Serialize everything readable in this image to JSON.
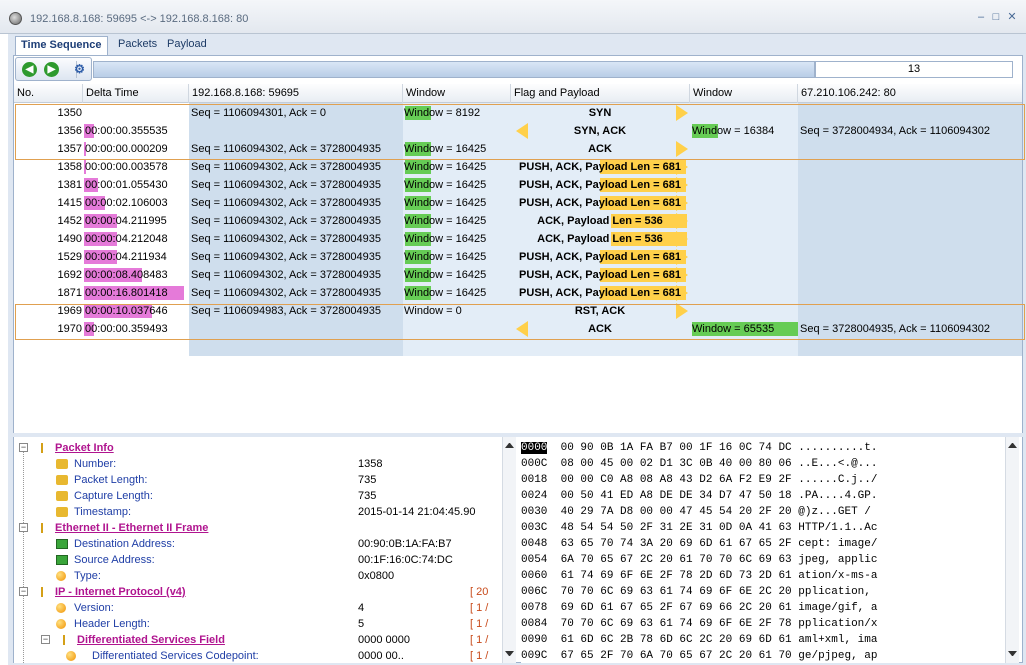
{
  "window": {
    "title": "192.168.8.168: 59695 <-> 192.168.8.168: 80"
  },
  "tabs": [
    {
      "label": "Time Sequence",
      "active": true
    },
    {
      "label": "Packets",
      "active": false
    },
    {
      "label": "Payload",
      "active": false
    }
  ],
  "toolbar": {
    "count": "13"
  },
  "columns": [
    "No.",
    "Delta Time",
    "192.168.8.168: 59695",
    "Window",
    "Flag and Payload",
    "Window",
    "67.210.106.242: 80"
  ],
  "colors": {
    "delta_bar": "#e57ad9",
    "window_bar": "#66cc55",
    "arrow": "#ffd04a",
    "group_border": "#e0a050"
  },
  "packets": [
    {
      "no": "1350",
      "delta": "",
      "seq_a": "Seq = 1106094301, Ack = 0",
      "win_a": "Window = 8192",
      "flag": "SYN",
      "dir": "right",
      "win_b": "",
      "seq_b": ""
    },
    {
      "no": "1356",
      "delta": "00:00:00.355535",
      "seq_a": "",
      "win_a": "",
      "flag": "SYN, ACK",
      "dir": "left",
      "win_b": "Window = 16384",
      "seq_b": "Seq = 3728004934, Ack = 1106094302"
    },
    {
      "no": "1357",
      "delta": "00:00:00.000209",
      "seq_a": "Seq = 1106094302, Ack = 3728004935",
      "win_a": "Window = 16425",
      "flag": "ACK",
      "dir": "right",
      "win_b": "",
      "seq_b": ""
    },
    {
      "no": "1358",
      "delta": "00:00:00.003578",
      "seq_a": "Seq = 1106094302, Ack = 3728004935",
      "win_a": "Window = 16425",
      "flag": "PUSH, ACK, Payload Len = 681",
      "dir": "right",
      "win_b": "",
      "seq_b": ""
    },
    {
      "no": "1381",
      "delta": "00:00:01.055430",
      "seq_a": "Seq = 1106094302, Ack = 3728004935",
      "win_a": "Window = 16425",
      "flag": "PUSH, ACK, Payload Len = 681",
      "dir": "right",
      "win_b": "",
      "seq_b": ""
    },
    {
      "no": "1415",
      "delta": "00:00:02.106003",
      "seq_a": "Seq = 1106094302, Ack = 3728004935",
      "win_a": "Window = 16425",
      "flag": "PUSH, ACK, Payload Len = 681",
      "dir": "right",
      "win_b": "",
      "seq_b": ""
    },
    {
      "no": "1452",
      "delta": "00:00:04.211995",
      "seq_a": "Seq = 1106094302, Ack = 3728004935",
      "win_a": "Window = 16425",
      "flag": "ACK, Payload Len = 536",
      "dir": "right",
      "win_b": "",
      "seq_b": ""
    },
    {
      "no": "1490",
      "delta": "00:00:04.212048",
      "seq_a": "Seq = 1106094302, Ack = 3728004935",
      "win_a": "Window = 16425",
      "flag": "ACK, Payload Len = 536",
      "dir": "right",
      "win_b": "",
      "seq_b": ""
    },
    {
      "no": "1529",
      "delta": "00:00:04.211934",
      "seq_a": "Seq = 1106094302, Ack = 3728004935",
      "win_a": "Window = 16425",
      "flag": "PUSH, ACK, Payload Len = 681",
      "dir": "right",
      "win_b": "",
      "seq_b": ""
    },
    {
      "no": "1692",
      "delta": "00:00:08.408483",
      "seq_a": "Seq = 1106094302, Ack = 3728004935",
      "win_a": "Window = 16425",
      "flag": "PUSH, ACK, Payload Len = 681",
      "dir": "right",
      "win_b": "",
      "seq_b": ""
    },
    {
      "no": "1871",
      "delta": "00:00:16.801418",
      "seq_a": "Seq = 1106094302, Ack = 3728004935",
      "win_a": "Window = 16425",
      "flag": "PUSH, ACK, Payload Len = 681",
      "dir": "right",
      "win_b": "",
      "seq_b": ""
    },
    {
      "no": "1969",
      "delta": "00:00:10.037646",
      "seq_a": "Seq = 1106094983, Ack = 3728004935",
      "win_a": "Window = 0",
      "flag": "RST, ACK",
      "dir": "right",
      "win_b": "",
      "seq_b": ""
    },
    {
      "no": "1970",
      "delta": "00:00:00.359493",
      "seq_a": "",
      "win_a": "",
      "flag": "ACK",
      "dir": "left",
      "win_b": "Window = 65535",
      "seq_b": "Seq = 3728004935, Ack = 1106094302"
    }
  ],
  "tree": [
    {
      "level": 0,
      "kind": "header",
      "icon": "node-icon",
      "label": "Packet Info",
      "value": "",
      "bracket": ""
    },
    {
      "level": 1,
      "kind": "field",
      "icon": "field-icon",
      "label": "Number:",
      "value": "1358",
      "bracket": ""
    },
    {
      "level": 1,
      "kind": "field",
      "icon": "field-icon",
      "label": "Packet Length:",
      "value": "735",
      "bracket": ""
    },
    {
      "level": 1,
      "kind": "field",
      "icon": "field-icon",
      "label": "Capture Length:",
      "value": "735",
      "bracket": ""
    },
    {
      "level": 1,
      "kind": "field",
      "icon": "field-icon",
      "label": "Timestamp:",
      "value": "2015-01-14 21:04:45.90",
      "bracket": ""
    },
    {
      "level": 0,
      "kind": "header",
      "icon": "node-icon",
      "label": "Ethernet II - Ethernet II Frame",
      "value": "",
      "bracket": ""
    },
    {
      "level": 1,
      "kind": "field",
      "icon": "mac-icon",
      "label": "Destination Address:",
      "value": "00:90:0B:1A:FA:B7",
      "bracket": ""
    },
    {
      "level": 1,
      "kind": "field",
      "icon": "mac-icon",
      "label": "Source Address:",
      "value": "00:1F:16:0C:74:DC",
      "bracket": ""
    },
    {
      "level": 1,
      "kind": "field",
      "icon": "orb-icon",
      "label": "Type:",
      "value": "0x0800",
      "bracket": ""
    },
    {
      "level": 0,
      "kind": "header",
      "icon": "node-icon",
      "label": "IP - Internet Protocol (v4)",
      "value": "",
      "bracket": "[ 20"
    },
    {
      "level": 1,
      "kind": "field",
      "icon": "orb-icon",
      "label": "Version:",
      "value": "4",
      "bracket": "[ 1 /"
    },
    {
      "level": 1,
      "kind": "field",
      "icon": "orb-icon",
      "label": "Header Length:",
      "value": "5",
      "bracket": "[ 1 /"
    },
    {
      "level": 1,
      "kind": "header",
      "icon": "node-icon",
      "label": "Differentiated Services Field",
      "value": "0000 0000",
      "bracket": "[ 1 /"
    },
    {
      "level": 2,
      "kind": "field",
      "icon": "orb-icon",
      "label": "Differentiated Services Codepoint:",
      "value": "0000 00..",
      "bracket": "[ 1 /"
    }
  ],
  "hex": {
    "selected": "0000",
    "rows": [
      {
        "off": "0000",
        "bytes": "00 90 0B 1A FA B7 00 1F 16 0C 74 DC",
        "ascii": "..........t."
      },
      {
        "off": "000C",
        "bytes": "08 00 45 00 02 D1 3C 0B 40 00 80 06",
        "ascii": "..E...<.@..."
      },
      {
        "off": "0018",
        "bytes": "00 00 C0 A8 08 A8 43 D2 6A F2 E9 2F",
        "ascii": "......C.j../"
      },
      {
        "off": "0024",
        "bytes": "00 50 41 ED A8 DE DE 34 D7 47 50 18",
        "ascii": ".PA....4.GP."
      },
      {
        "off": "0030",
        "bytes": "40 29 7A D8 00 00 47 45 54 20 2F 20",
        "ascii": "@)z...GET / "
      },
      {
        "off": "003C",
        "bytes": "48 54 54 50 2F 31 2E 31 0D 0A 41 63",
        "ascii": "HTTP/1.1..Ac"
      },
      {
        "off": "0048",
        "bytes": "63 65 70 74 3A 20 69 6D 61 67 65 2F",
        "ascii": "cept: image/"
      },
      {
        "off": "0054",
        "bytes": "6A 70 65 67 2C 20 61 70 70 6C 69 63",
        "ascii": "jpeg, applic"
      },
      {
        "off": "0060",
        "bytes": "61 74 69 6F 6E 2F 78 2D 6D 73 2D 61",
        "ascii": "ation/x-ms-a"
      },
      {
        "off": "006C",
        "bytes": "70 70 6C 69 63 61 74 69 6F 6E 2C 20",
        "ascii": "pplication, "
      },
      {
        "off": "0078",
        "bytes": "69 6D 61 67 65 2F 67 69 66 2C 20 61",
        "ascii": "image/gif, a"
      },
      {
        "off": "0084",
        "bytes": "70 70 6C 69 63 61 74 69 6F 6E 2F 78",
        "ascii": "pplication/x"
      },
      {
        "off": "0090",
        "bytes": "61 6D 6C 2B 78 6D 6C 2C 20 69 6D 61",
        "ascii": "aml+xml, ima"
      },
      {
        "off": "009C",
        "bytes": "67 65 2F 70 6A 70 65 67 2C 20 61 70",
        "ascii": "ge/pjpeg, ap"
      }
    ]
  }
}
